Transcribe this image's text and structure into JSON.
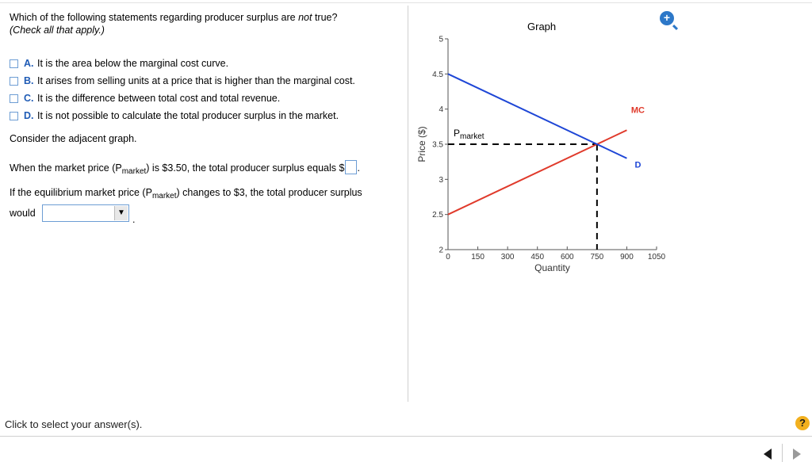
{
  "question": {
    "text_pre": "Which of the following statements regarding producer surplus are ",
    "text_em": "not",
    "text_post": " true?",
    "instruction": "(Check all that apply.)"
  },
  "options": [
    {
      "letter": "A.",
      "text": "It is the area below the marginal cost curve."
    },
    {
      "letter": "B.",
      "text": "It arises from selling units at a price that is higher than the marginal cost."
    },
    {
      "letter": "C.",
      "text": "It is the difference between total cost and total revenue."
    },
    {
      "letter": "D.",
      "text": "It is not possible to calculate the total producer surplus in the market."
    }
  ],
  "consider": "Consider the adjacent graph.",
  "q2": {
    "pre": "When the market price (P",
    "sub": "market",
    "post": ") is $3.50, the total producer surplus equals $",
    "end": "."
  },
  "q3": {
    "pre": "If the equilibrium market price (P",
    "sub": "market",
    "post": ") changes to $3, the total producer surplus",
    "would": "would",
    "end": "."
  },
  "graph": {
    "title": "Graph",
    "zoom_icon": "zoom-in-icon",
    "colors": {
      "supply": "#e03a2b",
      "demand": "#1e46d6"
    }
  },
  "chart_data": {
    "type": "line",
    "xlabel": "Quantity",
    "ylabel": "Price ($)",
    "xlim": [
      0,
      1050
    ],
    "ylim": [
      2,
      5
    ],
    "xticks": [
      0,
      150,
      300,
      450,
      600,
      750,
      900,
      1050
    ],
    "yticks": [
      2,
      2.5,
      3,
      3.5,
      4,
      4.5,
      5
    ],
    "series": [
      {
        "name": "MC",
        "x": [
          0,
          750,
          900
        ],
        "y": [
          2.5,
          3.5,
          3.7
        ]
      },
      {
        "name": "D",
        "x": [
          0,
          750,
          900
        ],
        "y": [
          4.5,
          3.5,
          3.3
        ]
      }
    ],
    "annotations": [
      {
        "label": "P",
        "sub": "market",
        "y": 3.5,
        "x_end": 750
      }
    ]
  },
  "status": "Click to select your answer(s).",
  "help_label": "?"
}
